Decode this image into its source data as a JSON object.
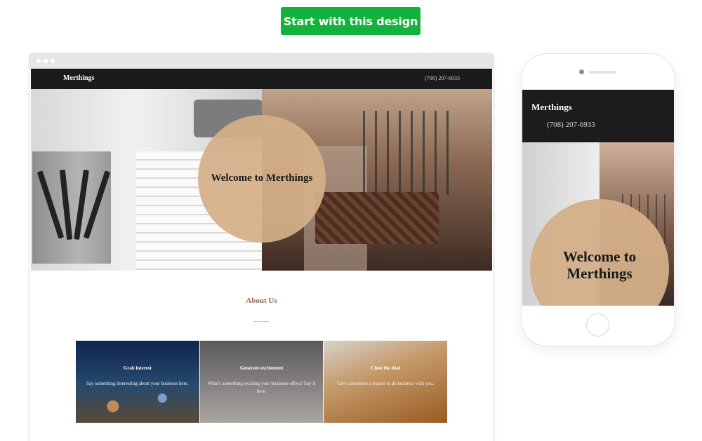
{
  "cta": {
    "label": "Start with this design"
  },
  "desktop_preview": {
    "header": {
      "logo": "Merthings",
      "phone": "(708) 207-6933"
    },
    "hero": {
      "title": "Welcome to Merthings"
    },
    "about": {
      "title": "About Us"
    },
    "cards": [
      {
        "title": "Grab interest",
        "text": "Say something interesting about your business here."
      },
      {
        "title": "Generate excitement",
        "text": "What's something exciting your business offers? Say it here."
      },
      {
        "title": "Close the deal",
        "text": "Give customers a reason to do business with you."
      }
    ]
  },
  "mobile_preview": {
    "header": {
      "logo": "Merthings",
      "phone": "(708) 207-6933"
    },
    "hero": {
      "title": "Welcome to Merthings"
    }
  },
  "colors": {
    "cta_green": "#13b23c",
    "header_dark": "#1a1a1a",
    "circle_tan": "#d4af89",
    "about_title": "#8a6a55"
  }
}
